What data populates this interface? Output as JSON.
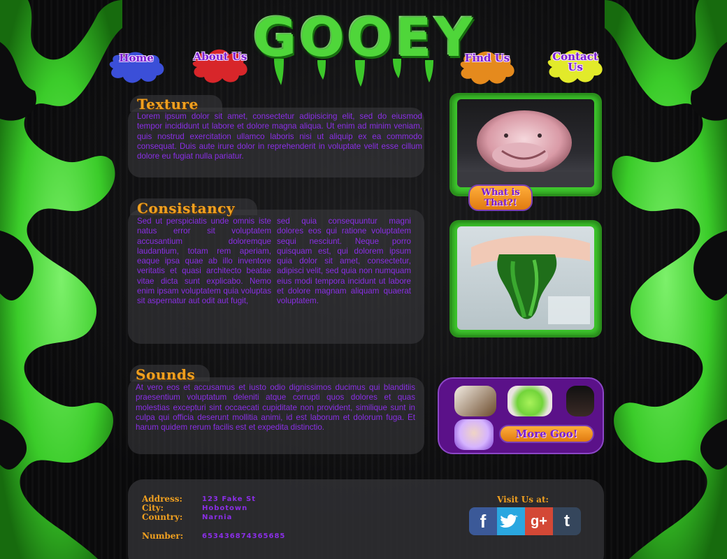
{
  "brand": {
    "logo_text": "GOOEY"
  },
  "nav": [
    {
      "label": "Home",
      "splat_color": "#3b4fd8"
    },
    {
      "label": "About Us",
      "splat_color": "#d8262a"
    },
    {
      "label": "Find Us",
      "splat_color": "#e58a1d"
    },
    {
      "label": "Contact Us",
      "splat_color": "#e2ea2a"
    }
  ],
  "sections": {
    "texture": {
      "heading": "Texture",
      "body": "Lorem ipsum dolor sit amet, consectetur adipisicing elit, sed do eiusmod tempor incididunt ut labore et dolore magna aliqua. Ut enim ad minim veniam, quis nostrud exercitation ullamco laboris nisi ut aliquip ex ea commodo consequat. Duis aute irure dolor in reprehenderit in voluptate velit esse cillum dolore eu fugiat nulla pariatur."
    },
    "consistancy": {
      "heading": "Consistancy",
      "col1": "Sed ut perspiciatis unde omnis iste natus error sit voluptatem accusantium doloremque laudantium, totam rem aperiam, eaque ipsa quae ab illo inventore veritatis et quasi architecto beatae vitae dicta sunt explicabo. Nemo enim ipsam voluptatem quia voluptas sit aspernatur aut odit aut fugit,",
      "col2": "sed quia consequuntur magni dolores eos qui ratione voluptatem sequi nesciunt. Neque porro quisquam est, qui dolorem ipsum quia dolor sit amet, consectetur, adipisci velit, sed quia non numquam eius modi tempora incidunt ut labore et dolore magnam aliquam quaerat voluptatem."
    },
    "sounds": {
      "heading": "Sounds",
      "body": "At vero eos et accusamus et iusto odio dignissimos ducimus qui blanditiis praesentium voluptatum deleniti atque corrupti quos dolores et quas molestias excepturi sint occaecati cupiditate non provident, similique sunt in culpa qui officia deserunt mollitia animi, id est laborum et dolorum fuga. Et harum quidem rerum facilis est et expedita distinctio."
    }
  },
  "side": {
    "blobfish_button": "What is That?!",
    "more_button": "More Goo!"
  },
  "footer": {
    "address_label": "Address:",
    "address_value": "123 Fake St",
    "city_label": "City:",
    "city_value": "Hobotown",
    "country_label": "Country:",
    "country_value": "Narnia",
    "number_label": "Number:",
    "number_value": "653436874365685",
    "visit_label": "Visit Us at:",
    "social": [
      {
        "icon": "facebook-icon",
        "glyph": "f",
        "color": "#3b5998"
      },
      {
        "icon": "twitter-icon",
        "glyph": "❝",
        "color": "#2aa7e0"
      },
      {
        "icon": "google-plus-icon",
        "glyph": "g+",
        "color": "#d34836"
      },
      {
        "icon": "tumblr-icon",
        "glyph": "t",
        "color": "#35465c"
      }
    ]
  },
  "colors": {
    "slime": "#3fc92e",
    "heading": "#f0a020",
    "text": "#8a2ee6",
    "goo_panel": "#5b1189"
  }
}
